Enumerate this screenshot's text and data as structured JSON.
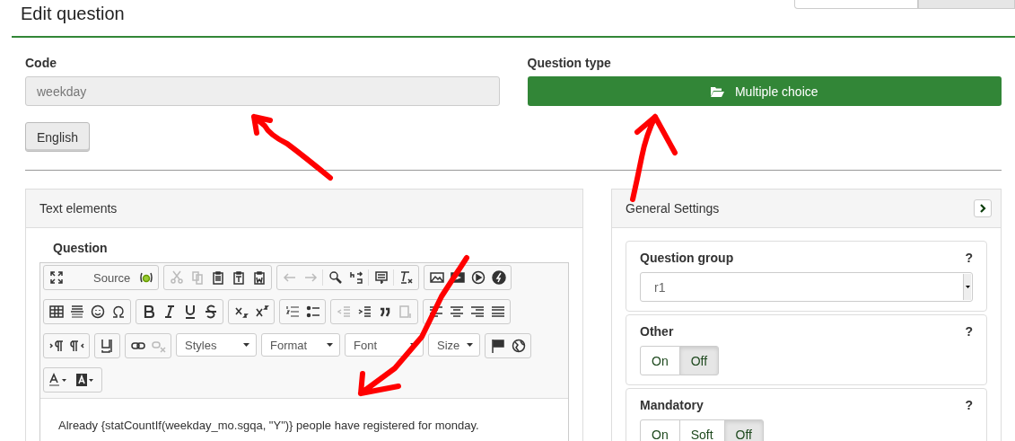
{
  "page_title": "Edit question",
  "code": {
    "label": "Code",
    "value": "weekday"
  },
  "question_type": {
    "label": "Question type",
    "button": "Multiple choice"
  },
  "language_button": "English",
  "text_elements": {
    "title": "Text elements",
    "field_label": "Question",
    "toolbar_labels": {
      "source": "Source",
      "styles": "Styles",
      "format": "Format",
      "font": "Font",
      "size": "Size"
    },
    "content": "Already {statCountIf(weekday_mo.sgqa, \"Y\")} people have registered for monday."
  },
  "general_settings": {
    "title": "General Settings",
    "settings": [
      {
        "kind": "select",
        "label": "Question group",
        "help": "?",
        "value": "r1"
      },
      {
        "kind": "toggle",
        "label": "Other",
        "help": "?",
        "options": [
          {
            "label": "On",
            "selected": false
          },
          {
            "label": "Off",
            "selected": true
          }
        ]
      },
      {
        "kind": "toggle",
        "label": "Mandatory",
        "help": "?",
        "options": [
          {
            "label": "On",
            "selected": false
          },
          {
            "label": "Soft",
            "selected": false
          },
          {
            "label": "Off",
            "selected": true
          }
        ]
      }
    ]
  }
}
